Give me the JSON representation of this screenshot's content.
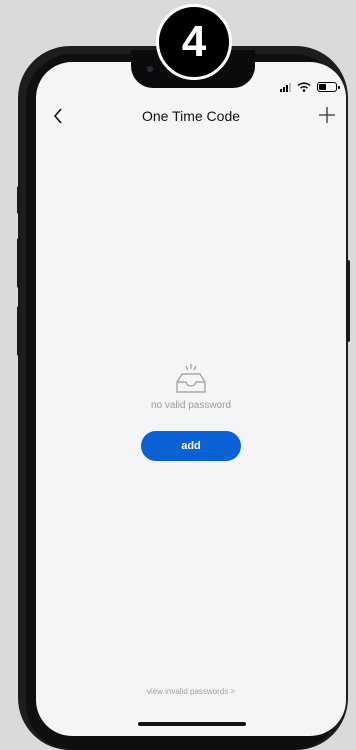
{
  "step_badge": "4",
  "navbar": {
    "title": "One Time Code",
    "back_icon": "chevron-left-icon",
    "add_icon": "plus-icon"
  },
  "status_bar": {
    "icons": [
      "signal-icon",
      "wifi-icon",
      "battery-icon"
    ]
  },
  "empty_state": {
    "icon": "empty-tray-icon",
    "message": "no valid password",
    "button_label": "add"
  },
  "footer": {
    "link_label": "view invalid passwords >"
  },
  "colors": {
    "accent": "#0a62d6",
    "screen_bg": "#f5f5f7",
    "muted_text": "#9a9a9a"
  }
}
